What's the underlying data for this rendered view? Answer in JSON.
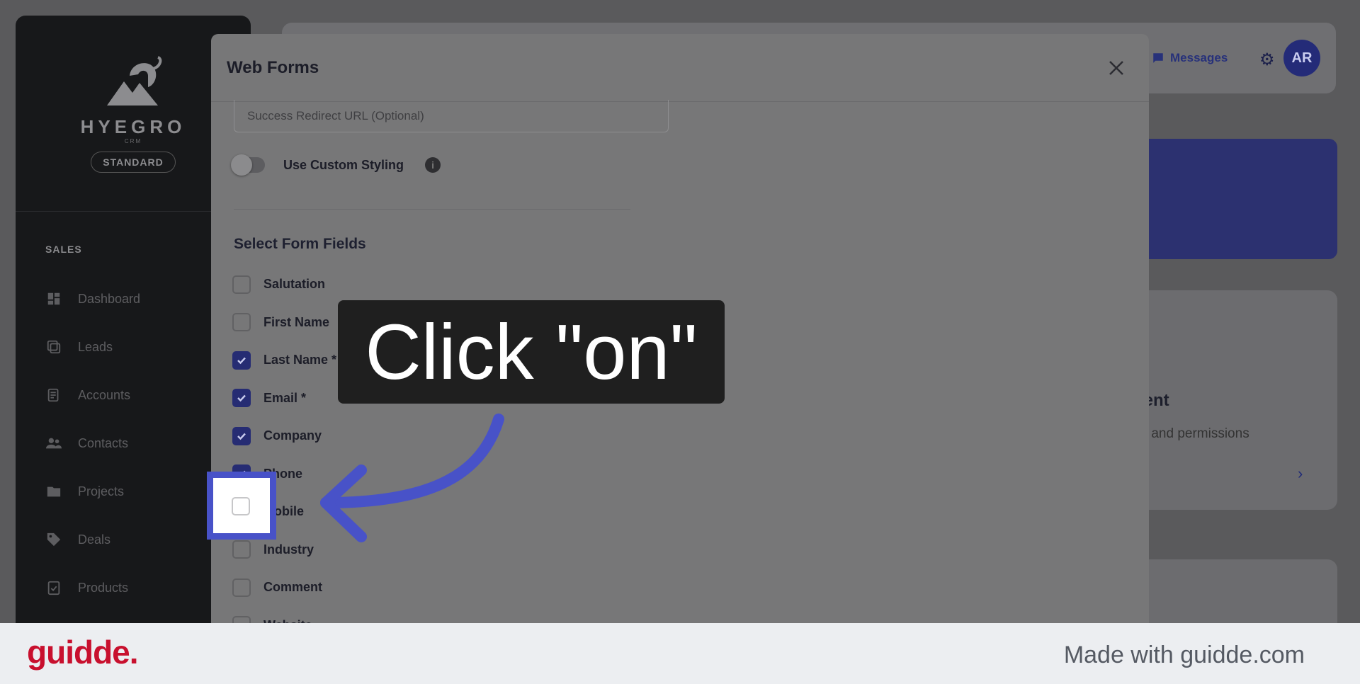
{
  "topbar": {
    "messages_label": "Messages",
    "avatar_initials": "AR"
  },
  "sidebar": {
    "brand_name": "HYEGRO",
    "brand_sub": "CRM",
    "plan_badge": "STANDARD",
    "section_label": "SALES",
    "items": [
      {
        "label": "Dashboard",
        "icon": "dashboard-icon"
      },
      {
        "label": "Leads",
        "icon": "leads-icon"
      },
      {
        "label": "Accounts",
        "icon": "accounts-icon"
      },
      {
        "label": "Contacts",
        "icon": "contacts-icon"
      },
      {
        "label": "Projects",
        "icon": "folder-icon"
      },
      {
        "label": "Deals",
        "icon": "tag-icon"
      },
      {
        "label": "Products",
        "icon": "clipboard-check-icon"
      }
    ]
  },
  "background_card": {
    "title": "nent",
    "subtitle": "es and permissions"
  },
  "modal": {
    "title": "Web Forms",
    "redirect_placeholder": "Success Redirect URL (Optional)",
    "custom_styling_label": "Use Custom Styling",
    "custom_styling_on": false,
    "fields_title": "Select Form Fields",
    "fields": [
      {
        "label": "Salutation",
        "checked": false
      },
      {
        "label": "First Name",
        "checked": false
      },
      {
        "label": "Last Name *",
        "checked": true
      },
      {
        "label": "Email *",
        "checked": true
      },
      {
        "label": "Company",
        "checked": true
      },
      {
        "label": "Phone",
        "checked": true
      },
      {
        "label": "Mobile",
        "checked": false
      },
      {
        "label": "Industry",
        "checked": false
      },
      {
        "label": "Comment",
        "checked": false
      },
      {
        "label": "Website",
        "checked": false
      }
    ]
  },
  "guide": {
    "instruction": "Click \"on\""
  },
  "footer": {
    "brand": "guidde.",
    "made_with": "Made with guidde.com"
  },
  "colors": {
    "accent": "#4852c8",
    "checkbox_checked": "#262c73",
    "brand_red": "#c8102e"
  }
}
